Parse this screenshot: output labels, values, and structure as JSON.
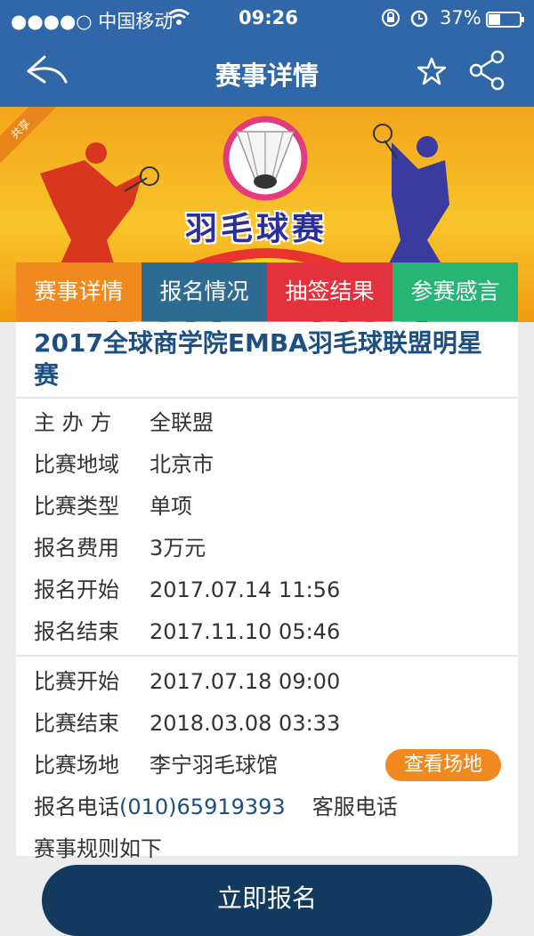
{
  "status": {
    "carrier": "●●●●○ 中国移动",
    "time": "09:26",
    "battery": "37%"
  },
  "nav": {
    "title": "赛事详情"
  },
  "banner": {
    "ribbon": "共享",
    "title": "羽毛球赛"
  },
  "tabs": [
    "赛事详情",
    "报名情况",
    "抽签结果",
    "参赛感言"
  ],
  "event": {
    "title": "2017全球商学院EMBA羽毛球联盟明星赛",
    "fields": [
      {
        "label": "主 办 方",
        "value": "全联盟"
      },
      {
        "label": "比赛地域",
        "value": "北京市"
      },
      {
        "label": "比赛类型",
        "value": "单项"
      },
      {
        "label": "报名费用",
        "value": "3万元"
      },
      {
        "label": "报名开始",
        "value": "2017.07.14 11:56"
      },
      {
        "label": "报名结束",
        "value": "2017.11.10 05:46"
      },
      {
        "label": "比赛开始",
        "value": "2017.07.18 09:00"
      },
      {
        "label": "比赛结束",
        "value": "2018.03.08 03:33"
      },
      {
        "label": "比赛场地",
        "value": "李宁羽毛球馆"
      }
    ],
    "phone_label": "报名电话",
    "phone": "(010)65919393",
    "service_phone": "客服电话",
    "rules": "赛事规则如下"
  },
  "buttons": {
    "venue": "查看场地",
    "register": "立即报名"
  },
  "colors": {
    "nav_blue": "#2f67a8",
    "orange": "#f08a1e",
    "teal_blue": "#2d6b93",
    "red": "#e3323e",
    "green": "#27b576",
    "title_blue": "#1d4f82",
    "register_navy": "#133a5e"
  },
  "icons": [
    "wifi-icon",
    "lock-icon",
    "alarm-icon",
    "battery-icon",
    "back-icon",
    "star-icon",
    "share-icon",
    "shuttlecock-icon"
  ]
}
